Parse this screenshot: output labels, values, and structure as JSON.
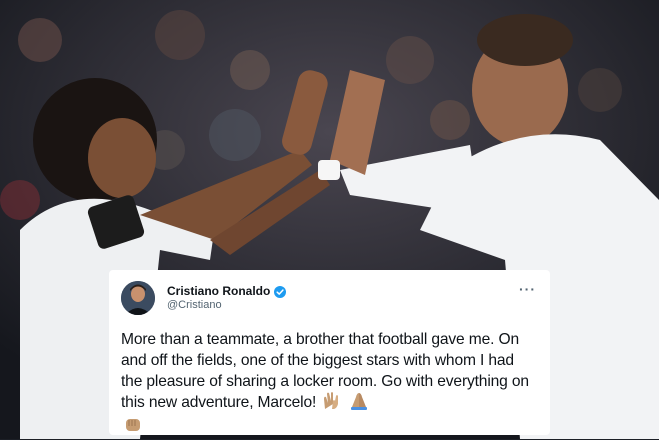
{
  "tweet": {
    "display_name": "Cristiano Ronaldo",
    "handle": "@Cristiano",
    "more_label": "···",
    "text": "More than a teammate, a brother that football gave me. On and off the fields, one of the biggest stars with whom I had the pleasure of sharing a locker room. Go with everything on this new adventure, Marcelo!",
    "emojis": [
      "clapping-hands",
      "folded-hands",
      "fist-bump"
    ]
  },
  "icons": {
    "verified": "verified-badge-icon",
    "more": "more-options-icon"
  },
  "colors": {
    "card_background": "#ffffff",
    "verified_blue": "#1d9bf0",
    "secondary_text": "#536471",
    "primary_text": "#0f1419"
  }
}
